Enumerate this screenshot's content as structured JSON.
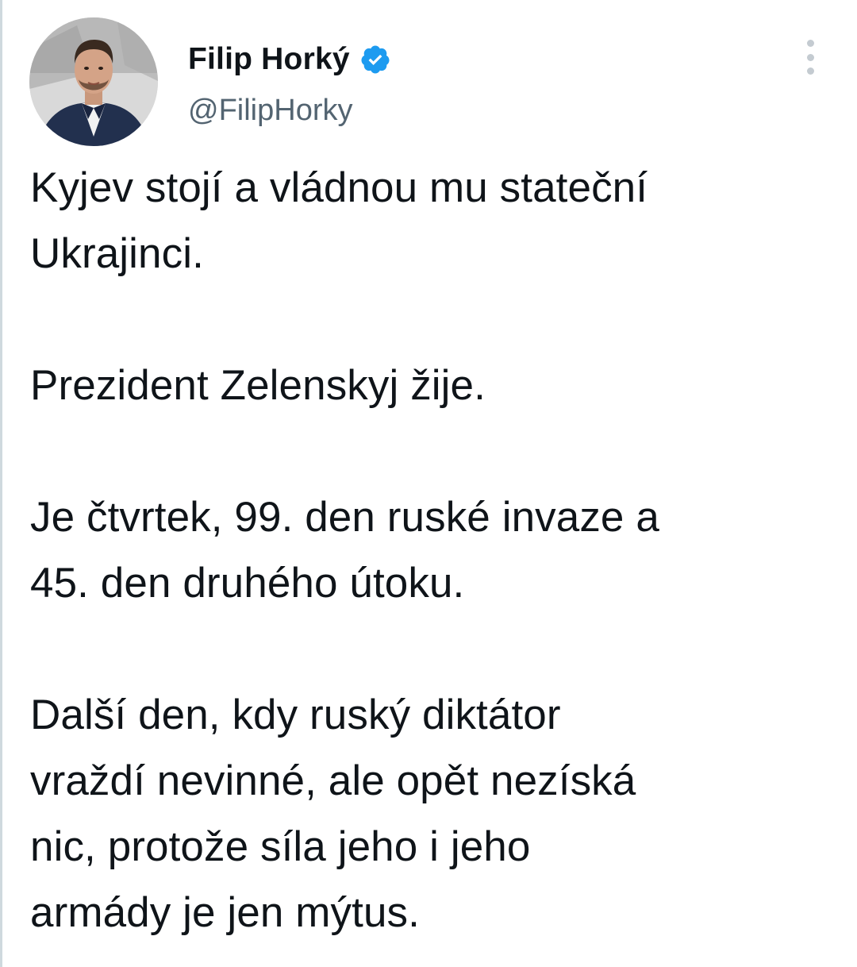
{
  "tweet": {
    "author": {
      "display_name": "Filip Horký",
      "handle": "@FilipHorky",
      "verified": true,
      "avatar_icon": "profile-photo"
    },
    "more_icon": "more-vertical-icon",
    "body": {
      "paragraphs": [
        [
          "Kyjev stojí a vládnou mu stateční",
          "Ukrajinci."
        ],
        [
          "Prezident Zelenskyj žije."
        ],
        [
          "Je čtvrtek, 99. den ruské invaze a",
          "45. den druhého útoku."
        ],
        [
          "Další den, kdy ruský diktátor",
          "vraždí nevinné, ale opět nezíská",
          "nic, protože síla jeho i jeho",
          "armády je jen mýtus."
        ]
      ]
    }
  },
  "colors": {
    "text": "#0f1419",
    "secondary_text": "#536471",
    "verified_badge": "#1d9bf0",
    "more_dots": "#c4cbd1"
  }
}
